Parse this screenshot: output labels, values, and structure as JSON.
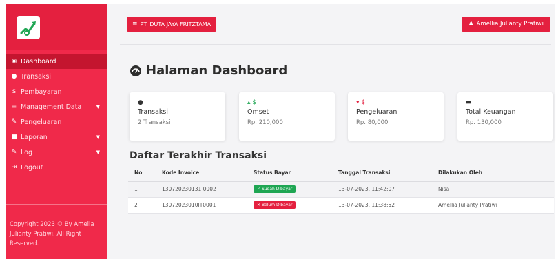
{
  "sidebar": {
    "logo_icon": "chart-trend-icon",
    "items": [
      {
        "icon": "dashboard-gauge-icon",
        "label": "Dashboard",
        "active": true
      },
      {
        "icon": "eye-icon",
        "label": "Transaksi"
      },
      {
        "icon": "dollar-icon",
        "label": "Pembayaran"
      },
      {
        "icon": "list-icon",
        "label": "Management Data",
        "has_caret": true
      },
      {
        "icon": "edit-icon",
        "label": "Pengeluaran"
      },
      {
        "icon": "file-icon",
        "label": "Laporan",
        "has_caret": true
      },
      {
        "icon": "edit-icon",
        "label": "Log",
        "has_caret": true
      },
      {
        "icon": "logout-icon",
        "label": "Logout"
      }
    ],
    "copyright": "Copyright 2023 © By Amelia Julianty Pratiwi. All Right Reserved."
  },
  "topbar": {
    "company": "PT. DUTA JAYA FRITZTAMA",
    "user": "Amellia Julianty Pratiwi"
  },
  "page": {
    "title": "Halaman Dashboard"
  },
  "cards": [
    {
      "icon": "eye-icon",
      "label": "Transaksi",
      "value": "2 Transaksi"
    },
    {
      "icon": "arrow-up-dollar-icon",
      "label": "Omset",
      "value": "Rp. 210,000"
    },
    {
      "icon": "arrow-down-dollar-icon",
      "label": "Pengeluaran",
      "value": "Rp. 80,000"
    },
    {
      "icon": "wallet-icon",
      "label": "Total Keuangan",
      "value": "Rp. 130,000"
    }
  ],
  "table": {
    "title": "Daftar Terakhir Transaksi",
    "headers": [
      "No",
      "Kode Invoice",
      "Status Bayar",
      "Tanggal Transaksi",
      "Dilakukan Oleh"
    ],
    "rows": [
      {
        "no": "1",
        "invoice": "130720230131 0002",
        "status": "Sudah Dibayar",
        "status_type": "paid",
        "date": "13-07-2023, 11:42:07",
        "by": "Nisa"
      },
      {
        "no": "2",
        "invoice": "13072023010IT0001",
        "status": "Belum Dibayar",
        "status_type": "unpaid",
        "date": "13-07-2023, 11:38:52",
        "by": "Amellia Julianty Pratiwi"
      }
    ]
  },
  "colors": {
    "sidebar": "#f0294a",
    "sidebar_active": "#c4152f",
    "accent": "#e4203f",
    "success": "#1fa653"
  }
}
